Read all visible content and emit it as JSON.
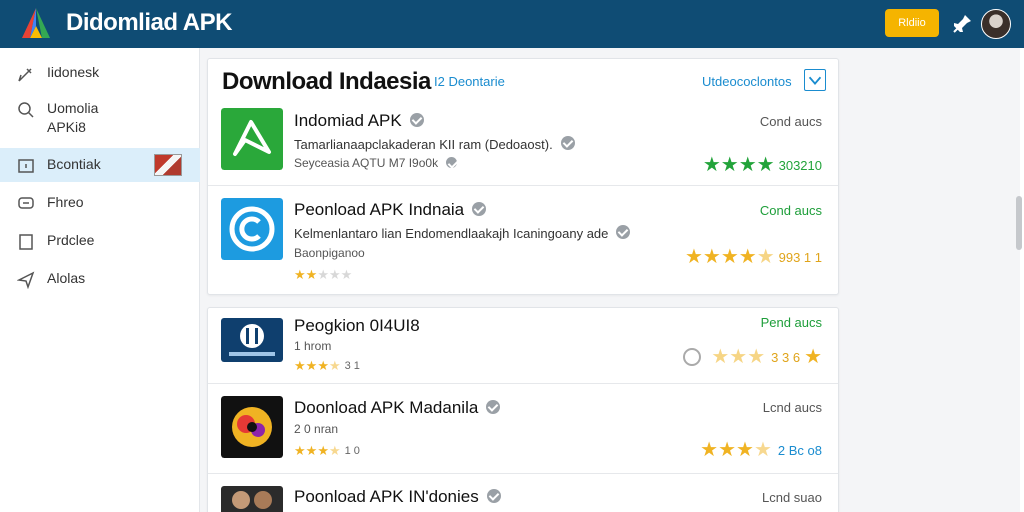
{
  "header": {
    "title": "Didomliad APK",
    "button_label": "Rldiio",
    "icons": [
      "app-logo-icon",
      "pin-icon",
      "avatar"
    ]
  },
  "sidebar": {
    "items": [
      {
        "label": "Iidonesk",
        "icon": "pen-icon"
      },
      {
        "label": "Uomolia\nAPKi8",
        "icon": "search-icon"
      },
      {
        "label": "Bcontiak",
        "icon": "image-icon",
        "active": true
      },
      {
        "label": "Fhreo",
        "icon": "chat-icon"
      },
      {
        "label": "Prdclee",
        "icon": "square-icon"
      },
      {
        "label": "Alolas",
        "icon": "send-icon"
      }
    ]
  },
  "card1": {
    "title": "Download Indaesia",
    "subtitle": "I2 Deontarie",
    "link": "Utdeococlontos",
    "apps": [
      {
        "name": "Indomiad APK",
        "desc": "Tamarlianaapclakaderan KII ram (Dedoaost).",
        "meta": "Seyceasia  AQTU M7 I9o0k",
        "status": "Cond aucs",
        "stars_full": 4,
        "rating_text": "303210",
        "icon_color": "#2aa83a"
      },
      {
        "name": "Peonload APK Indnaia",
        "desc": "Kelmenlantaro lian Endomendlaakajh Icaningoany ade",
        "meta": "Baonpiganoo",
        "status": "Cond aucs",
        "stars_full": 4,
        "rating_text": "993 1 1",
        "icon_color": "#1d9be0"
      }
    ]
  },
  "card2": {
    "apps": [
      {
        "name": "Peogkion 0I4UI8",
        "meta": "1 hrom",
        "small_rating": "3 1",
        "status": "Pend aucs",
        "rating_text": "3 3 6"
      },
      {
        "name": "Doonload APK Madanila",
        "meta": "2 0 nran",
        "small_rating": "1 0",
        "status": "Lcnd aucs",
        "rating_text": "2 Bc o8"
      },
      {
        "name": "Poonload APK IN'donies",
        "status": "Lcnd suao"
      }
    ]
  }
}
